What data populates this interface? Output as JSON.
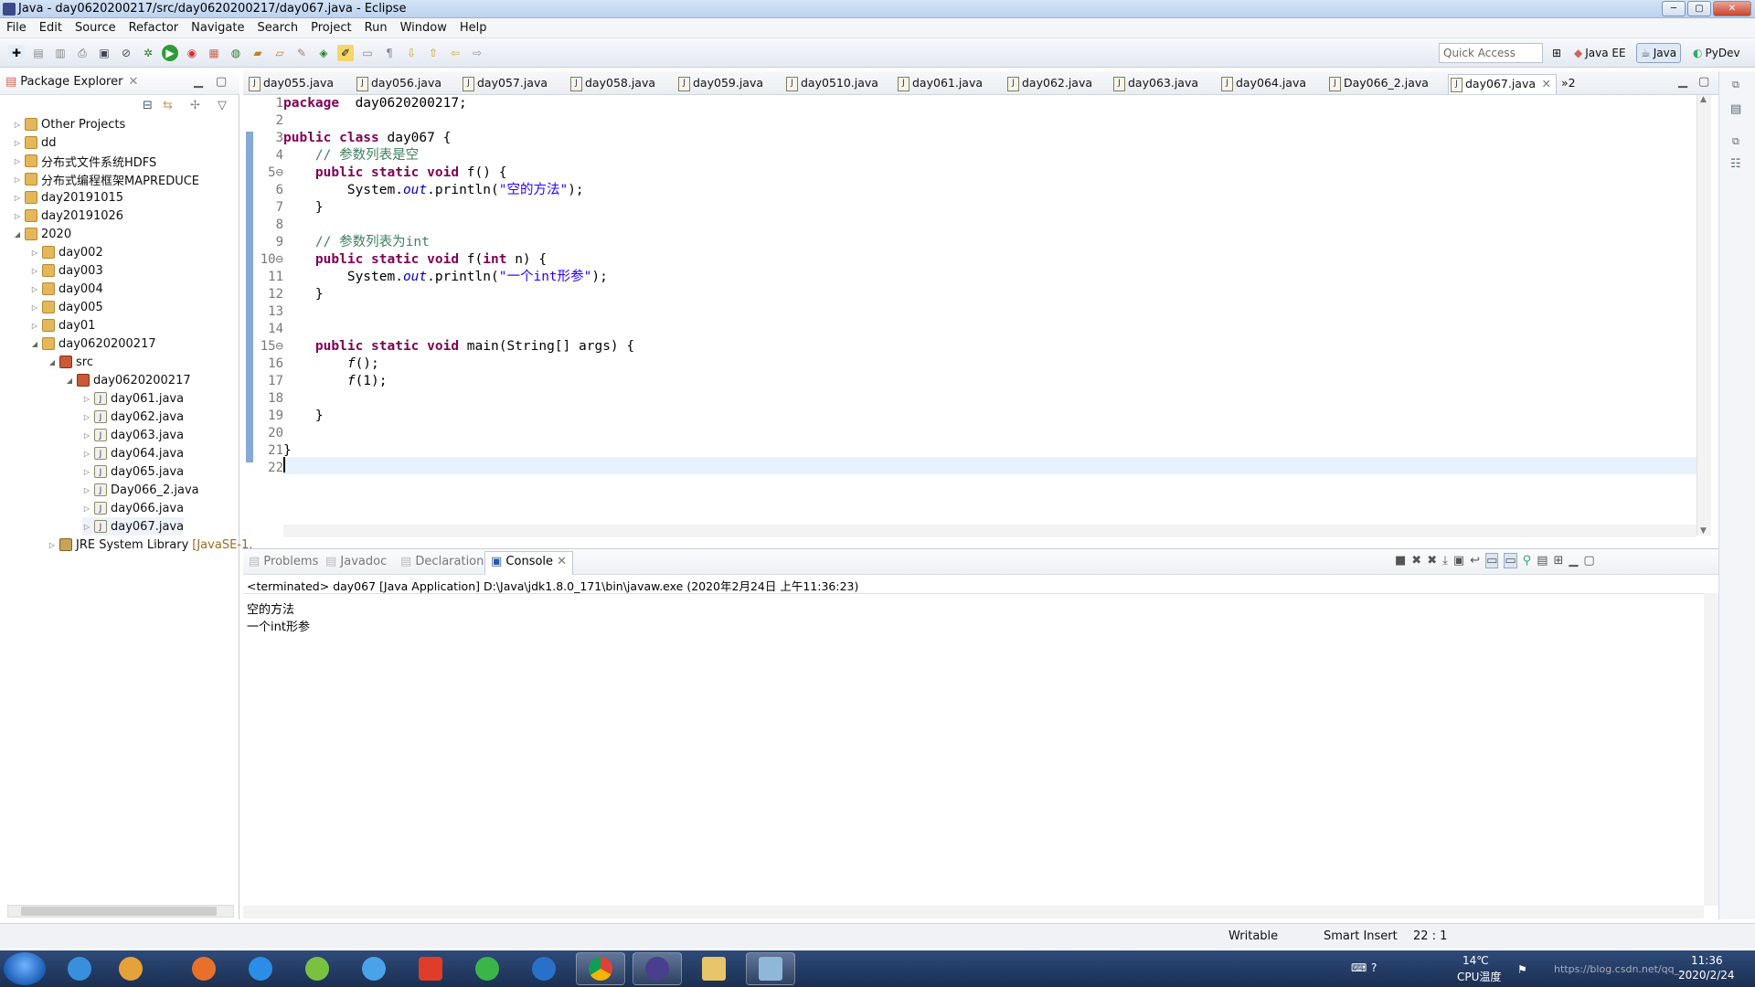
{
  "window": {
    "title": "Java - day0620200217/src/day0620200217/day067.java - Eclipse"
  },
  "menu": [
    "File",
    "Edit",
    "Source",
    "Refactor",
    "Navigate",
    "Search",
    "Project",
    "Run",
    "Window",
    "Help"
  ],
  "toolbar": {
    "quick_access_placeholder": "Quick Access",
    "perspectives": [
      {
        "label": "Java EE"
      },
      {
        "label": "Java"
      },
      {
        "label": "PyDev"
      }
    ]
  },
  "package_explorer": {
    "title": "Package Explorer",
    "items": [
      {
        "label": "Other Projects",
        "depth": 0,
        "kind": "proj",
        "arrow": "▷"
      },
      {
        "label": "dd",
        "depth": 0,
        "kind": "proj",
        "arrow": "▷"
      },
      {
        "label": "分布式文件系统HDFS",
        "depth": 0,
        "kind": "proj",
        "arrow": "▷"
      },
      {
        "label": "分布式编程框架MAPREDUCE",
        "depth": 0,
        "kind": "proj",
        "arrow": "▷"
      },
      {
        "label": "day20191015",
        "depth": 0,
        "kind": "proj",
        "arrow": "▷"
      },
      {
        "label": "day20191026",
        "depth": 0,
        "kind": "proj",
        "arrow": "▷"
      },
      {
        "label": "2020",
        "depth": 0,
        "kind": "proj",
        "arrow": "◢"
      },
      {
        "label": "day002",
        "depth": 1,
        "kind": "proj",
        "arrow": "▷"
      },
      {
        "label": "day003",
        "depth": 1,
        "kind": "proj",
        "arrow": "▷"
      },
      {
        "label": "day004",
        "depth": 1,
        "kind": "proj",
        "arrow": "▷"
      },
      {
        "label": "day005",
        "depth": 1,
        "kind": "proj",
        "arrow": "▷"
      },
      {
        "label": "day01",
        "depth": 1,
        "kind": "proj",
        "arrow": "▷"
      },
      {
        "label": "day0620200217",
        "depth": 1,
        "kind": "proj",
        "arrow": "◢"
      },
      {
        "label": "src",
        "depth": 2,
        "kind": "pkg",
        "arrow": "◢"
      },
      {
        "label": "day0620200217",
        "depth": 3,
        "kind": "pkg",
        "arrow": "◢"
      },
      {
        "label": "day061.java",
        "depth": 4,
        "kind": "jfile",
        "arrow": "▷"
      },
      {
        "label": "day062.java",
        "depth": 4,
        "kind": "jfile",
        "arrow": "▷"
      },
      {
        "label": "day063.java",
        "depth": 4,
        "kind": "jfile",
        "arrow": "▷"
      },
      {
        "label": "day064.java",
        "depth": 4,
        "kind": "jfile",
        "arrow": "▷"
      },
      {
        "label": "day065.java",
        "depth": 4,
        "kind": "jfile",
        "arrow": "▷"
      },
      {
        "label": "Day066_2.java",
        "depth": 4,
        "kind": "jfile",
        "arrow": "▷"
      },
      {
        "label": "day066.java",
        "depth": 4,
        "kind": "jfile",
        "arrow": "▷"
      },
      {
        "label": "day067.java",
        "depth": 4,
        "kind": "jfile",
        "arrow": "▷"
      },
      {
        "label": "JRE System Library",
        "suffix": "[JavaSE-1.",
        "depth": 2,
        "kind": "lib",
        "arrow": "▷"
      }
    ]
  },
  "editor": {
    "tabs": [
      "day055.java",
      "day056.java",
      "day057.java",
      "day058.java",
      "day059.java",
      "day0510.java",
      "day061.java",
      "day062.java",
      "day063.java",
      "day064.java",
      "Day066_2.java",
      "day067.java"
    ],
    "active_tab": "day067.java",
    "overflow": "»2",
    "lines": [
      {
        "n": "1",
        "parts": [
          [
            "kw",
            "package"
          ],
          [
            "",
            "  day0620200217;"
          ]
        ]
      },
      {
        "n": "2",
        "parts": []
      },
      {
        "n": "3",
        "parts": [
          [
            "kw",
            "public class"
          ],
          [
            "",
            " day067 {"
          ]
        ]
      },
      {
        "n": "4",
        "parts": [
          [
            "",
            "    "
          ],
          [
            "cm",
            "// 参数列表是空"
          ]
        ]
      },
      {
        "n": "5⊖",
        "parts": [
          [
            "",
            "    "
          ],
          [
            "kw",
            "public static void"
          ],
          [
            "",
            " f() {"
          ]
        ]
      },
      {
        "n": "6",
        "parts": [
          [
            "",
            "        System."
          ],
          [
            "fld",
            "out"
          ],
          [
            "",
            ".println("
          ],
          [
            "str",
            "\"空的方法\""
          ],
          [
            "",
            ");"
          ]
        ]
      },
      {
        "n": "7",
        "parts": [
          [
            "",
            "    }"
          ]
        ]
      },
      {
        "n": "8",
        "parts": []
      },
      {
        "n": "9",
        "parts": [
          [
            "",
            "    "
          ],
          [
            "cm",
            "// 参数列表为int"
          ]
        ]
      },
      {
        "n": "10⊖",
        "parts": [
          [
            "",
            "    "
          ],
          [
            "kw",
            "public static void"
          ],
          [
            "",
            " f("
          ],
          [
            "kw",
            "int"
          ],
          [
            "",
            " n) {"
          ]
        ]
      },
      {
        "n": "11",
        "parts": [
          [
            "",
            "        System."
          ],
          [
            "fld",
            "out"
          ],
          [
            "",
            ".println("
          ],
          [
            "str",
            "\"一个int形参\""
          ],
          [
            "",
            ");"
          ]
        ]
      },
      {
        "n": "12",
        "parts": [
          [
            "",
            "    }"
          ]
        ]
      },
      {
        "n": "13",
        "parts": []
      },
      {
        "n": "14",
        "parts": []
      },
      {
        "n": "15⊖",
        "parts": [
          [
            "",
            "    "
          ],
          [
            "kw",
            "public static void"
          ],
          [
            "",
            " main(String[] args) {"
          ]
        ]
      },
      {
        "n": "16",
        "parts": [
          [
            "",
            "        "
          ],
          [
            "itc",
            "f"
          ],
          [
            "",
            "();"
          ]
        ]
      },
      {
        "n": "17",
        "parts": [
          [
            "",
            "        "
          ],
          [
            "itc",
            "f"
          ],
          [
            "",
            "(1);"
          ]
        ]
      },
      {
        "n": "18",
        "parts": []
      },
      {
        "n": "19",
        "parts": [
          [
            "",
            "    }"
          ]
        ]
      },
      {
        "n": "20",
        "parts": []
      },
      {
        "n": "21",
        "parts": [
          [
            "",
            "}"
          ]
        ]
      },
      {
        "n": "22",
        "parts": []
      }
    ]
  },
  "console": {
    "tabs": [
      "Problems",
      "Javadoc",
      "Declaration",
      "Console"
    ],
    "active": "Console",
    "status": "<terminated> day067 [Java Application] D:\\Java\\jdk1.8.0_171\\bin\\javaw.exe (2020年2月24日 上午11:36:23)",
    "output": [
      "空的方法",
      "一个int形参"
    ]
  },
  "statusbar": {
    "writable": "Writable",
    "insert": "Smart Insert",
    "position": "22 : 1"
  },
  "taskbar": {
    "temp": "14℃",
    "cpu": "CPU温度",
    "time": "11:36",
    "date": "2020/2/24",
    "watermark": "https://blog.csdn.net/qq_..."
  }
}
